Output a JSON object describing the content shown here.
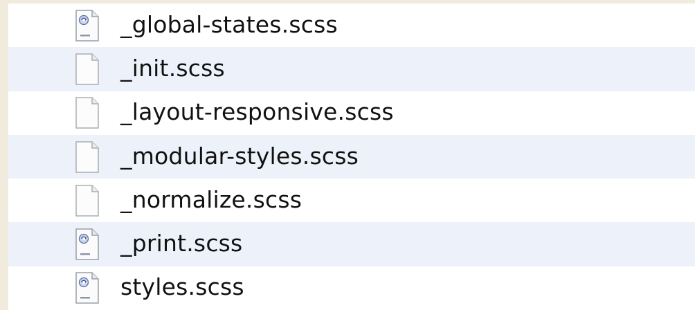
{
  "files": [
    {
      "name": "_global-states.scss",
      "icon": "script-doc-icon"
    },
    {
      "name": "_init.scss",
      "icon": "blank-doc-icon"
    },
    {
      "name": "_layout-responsive.scss",
      "icon": "blank-doc-icon"
    },
    {
      "name": "_modular-styles.scss",
      "icon": "blank-doc-icon"
    },
    {
      "name": "_normalize.scss",
      "icon": "blank-doc-icon"
    },
    {
      "name": "_print.scss",
      "icon": "script-doc-icon"
    },
    {
      "name": "styles.scss",
      "icon": "script-doc-icon"
    }
  ],
  "colors": {
    "background": "#f1ebdd",
    "row_alt": "#edf2fa",
    "row": "#ffffff",
    "text": "#111111"
  }
}
